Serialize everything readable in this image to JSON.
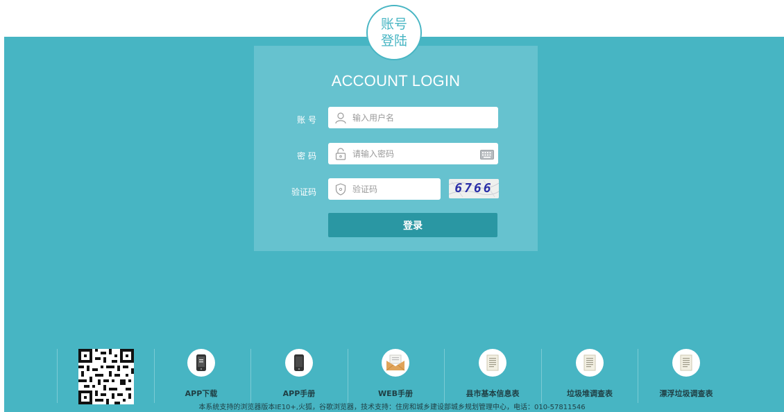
{
  "header": {
    "badge_line1": "账号",
    "badge_line2": "登陆"
  },
  "login": {
    "title": "ACCOUNT LOGIN",
    "username_label": "账 号",
    "username_placeholder": "输入用户名",
    "password_label": "密 码",
    "password_placeholder": "请输入密码",
    "captcha_label": "验证码",
    "captcha_placeholder": "验证码",
    "captcha_text": "6766",
    "submit_label": "登录"
  },
  "footer": {
    "items": [
      {
        "label": "APP下载",
        "icon": "phone-download-icon"
      },
      {
        "label": "APP手册",
        "icon": "phone-icon"
      },
      {
        "label": "WEB手册",
        "icon": "envelope-icon"
      },
      {
        "label": "县市基本信息表",
        "icon": "document-icon"
      },
      {
        "label": "垃圾堆调查表",
        "icon": "document-icon"
      },
      {
        "label": "漂浮垃圾调查表",
        "icon": "document-icon"
      }
    ],
    "copyright": "本系统支持的浏览器版本IE10+,火狐，谷歌浏览器，技术支持：住房和城乡建设部城乡规划管理中心，电话：010-57811546"
  },
  "colors": {
    "band": "#47b5c3",
    "panel": "#66c2cf",
    "button": "#2a97a3"
  }
}
